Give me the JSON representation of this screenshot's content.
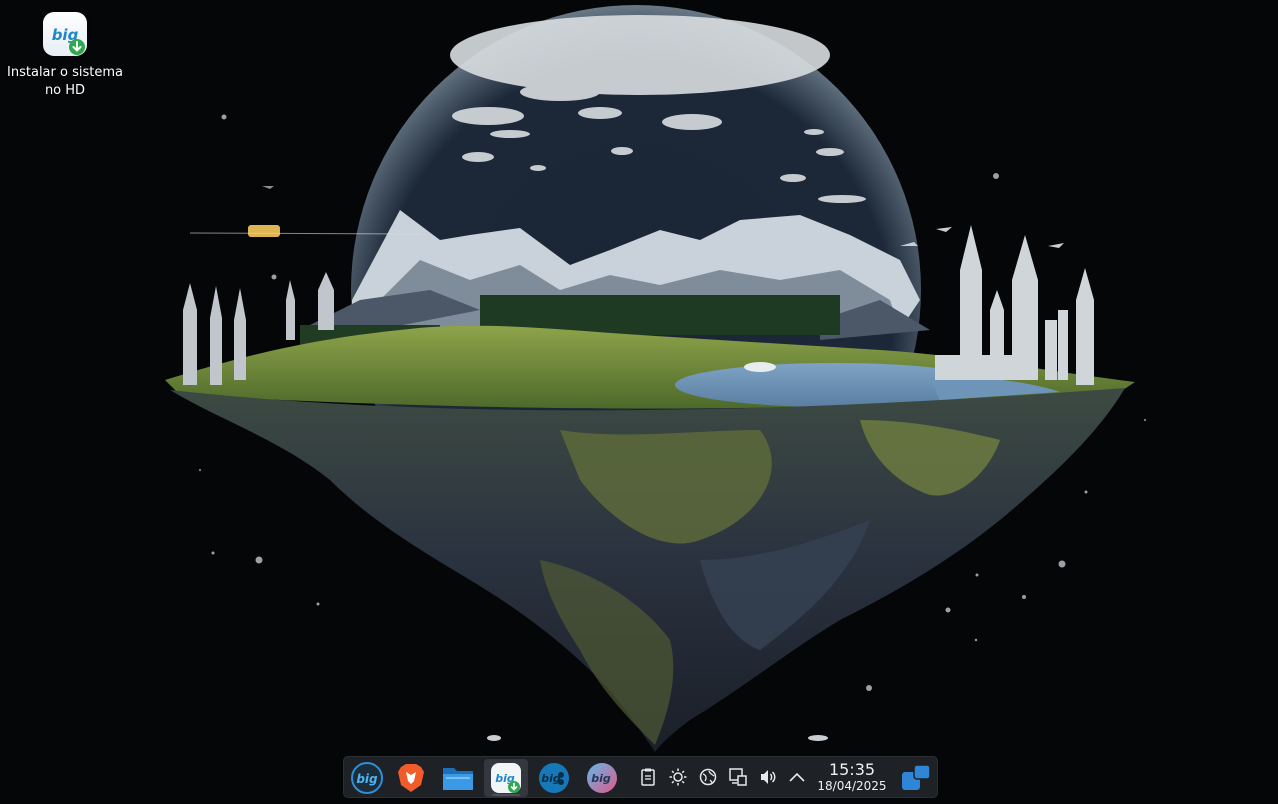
{
  "desktop": {
    "icons": [
      {
        "label": "Instalar o sistema no HD",
        "icon": "big-installer-icon"
      }
    ]
  },
  "taskbar": {
    "launchers": [
      {
        "name": "big-menu-icon",
        "active": false
      },
      {
        "name": "brave-browser-icon",
        "active": false
      },
      {
        "name": "file-manager-icon",
        "active": false
      },
      {
        "name": "big-installer-icon",
        "active": true
      },
      {
        "name": "big-store-icon",
        "active": false
      },
      {
        "name": "big-welcome-icon",
        "active": false
      }
    ],
    "tray": [
      "clipboard-icon",
      "brightness-icon",
      "network-globe-icon",
      "display-icon",
      "volume-icon",
      "chevron-up-icon"
    ],
    "clock": {
      "time": "15:35",
      "date": "18/04/2025"
    },
    "show_desktop": "show-desktop-icon"
  },
  "colors": {
    "taskbar_bg": "#1e2125",
    "accent": "#3a8fd8",
    "install_badge": "#2fa84f"
  }
}
